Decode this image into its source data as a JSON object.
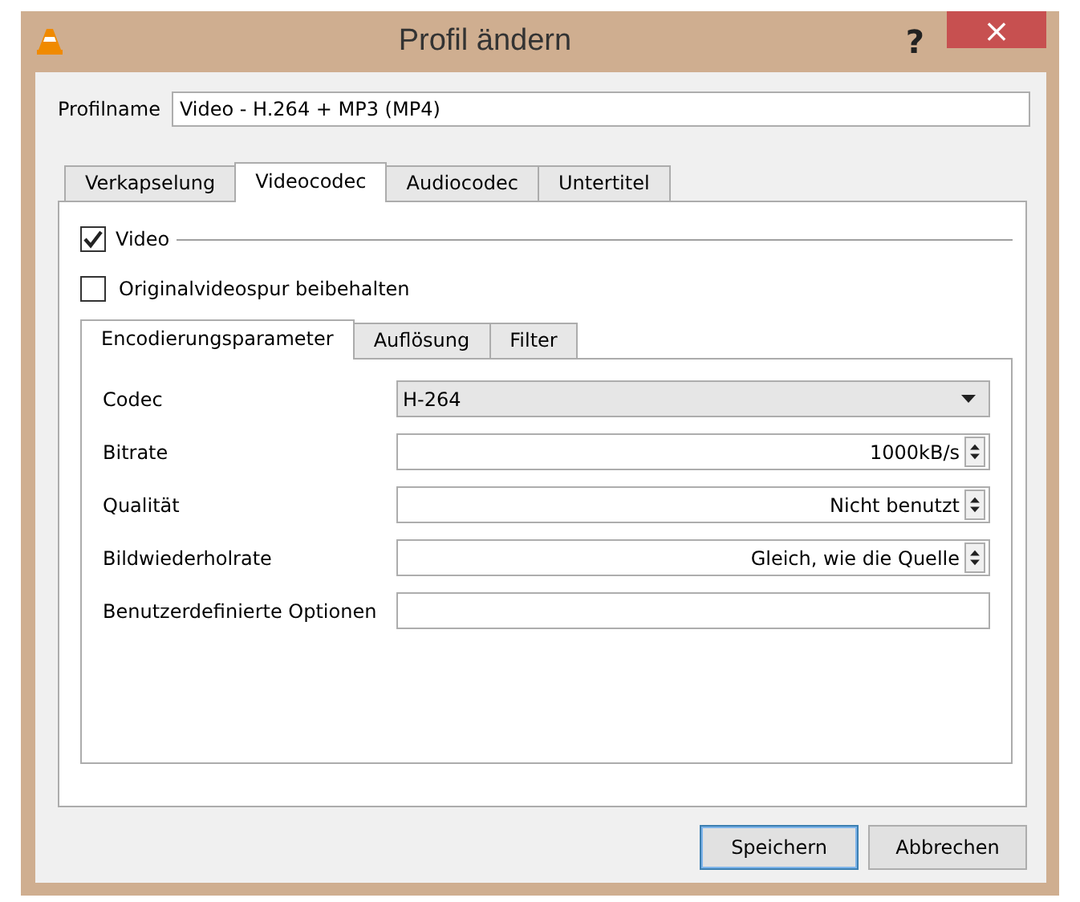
{
  "window": {
    "title": "Profil ändern",
    "help_glyph": "?",
    "close_glyph": "×"
  },
  "profile": {
    "label": "Profilname",
    "value": "Video - H.264 + MP3 (MP4)"
  },
  "tabs": [
    {
      "label": "Verkapselung",
      "selected": false
    },
    {
      "label": "Videocodec",
      "selected": true
    },
    {
      "label": "Audiocodec",
      "selected": false
    },
    {
      "label": "Untertitel",
      "selected": false
    }
  ],
  "video_group": {
    "label": "Video",
    "checked": true
  },
  "keep_original": {
    "label": "Originalvideospur beibehalten",
    "checked": false
  },
  "subtabs": [
    {
      "label": "Encodierungsparameter",
      "selected": true
    },
    {
      "label": "Auflösung",
      "selected": false
    },
    {
      "label": "Filter",
      "selected": false
    }
  ],
  "params": [
    {
      "label": "Codec",
      "kind": "select",
      "value": "H-264"
    },
    {
      "label": "Bitrate",
      "kind": "spin",
      "value": "1000kB/s"
    },
    {
      "label": "Qualität",
      "kind": "spin",
      "value": "Nicht benutzt"
    },
    {
      "label": "Bildwiederholrate",
      "kind": "spin",
      "value": "Gleich, wie die Quelle"
    },
    {
      "label": "Benutzerdefinierte Optionen",
      "kind": "text"
    }
  ],
  "buttons": [
    {
      "label": "Speichern",
      "default": true
    },
    {
      "label": "Abbrechen",
      "default": false
    }
  ]
}
